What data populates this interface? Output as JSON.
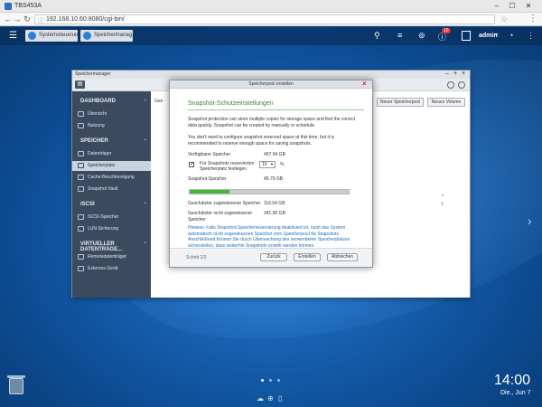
{
  "browser": {
    "tab_title": "TBS453A",
    "url": "192.168.10.60:8080/cgi-bin/",
    "minimize": "–",
    "maximize": "☐",
    "close": "✕"
  },
  "taskbar": {
    "apps": [
      {
        "label": "Systemsteuerun..."
      },
      {
        "label": "Speichermanag..."
      }
    ],
    "notification_count": "10",
    "user": "admin"
  },
  "storage_manager": {
    "title": "Speichermanager",
    "sidebar": {
      "sections": [
        {
          "heading": "DASHBOARD",
          "items": [
            "Übersicht",
            "Nutzung"
          ]
        },
        {
          "heading": "SPEICHER",
          "items": [
            "Datenträger",
            "Speicherplatz",
            "Cache-Beschleunigung",
            "Snapshot Vault"
          ]
        },
        {
          "heading": "iSCSI",
          "items": [
            "iSCSI-Speicher",
            "LUN-Sicherung"
          ]
        },
        {
          "heading": "VIRTUELLER DATENTRÄGE...",
          "items": [
            "Remotedatenträger",
            "Externes Gerät"
          ]
        }
      ],
      "active_item": "Speicherplatz"
    },
    "buttons": {
      "new_pool": "Neuer Speicherpool",
      "new_volume": "Neues Volume"
    },
    "content_label": "Ges",
    "content_marks": [
      "*",
      "I"
    ]
  },
  "dialog": {
    "title": "Speicherpool erstellen",
    "close_icon": "×",
    "heading": "Snapshot-Schutzeinstellungen",
    "intro": "Snapshot protection can store multiple copies for storage space and find the correct data quickly. Snapshot can be created by manually or schedule.",
    "note": "You don't need to configure snapshot reserved space at this time, but it is recommended to reserve enough space for saving snapshots.",
    "available_label": "Verfügbarer Speicher",
    "available_value": "457.94 GB",
    "reserve_checkbox_label": "Für Snapshots reservierten Speicherplatz festlegen",
    "reserve_checked": true,
    "reserve_percent": "10",
    "percent_unit": "%",
    "snapshot_label": "Snapshot-Speicher",
    "snapshot_value": "45.79 GB",
    "snapshot_fill_fraction": 0.25,
    "estimated_label": "Geschätzter zugewiesener Speicher",
    "estimated_value": "116.54 GB",
    "unassigned_label": "Geschätzter nicht zugewiesener Speicher",
    "unassigned_value": "341.00 GB",
    "hint": "Hinweis: Falls Snapshot-Speicherreservierung deaktiviert ist, nutzt das System automatisch nicht zugewiesenen Speicher vom Speicherpool für Snapshots. Anschließend können Sie durch Überwachung des verwendeten Speicherplatzes sicherstellen, dass weiterhin Snapshots erstellt werden können.",
    "step": "Schritt 2/2",
    "back": "Zurück",
    "create": "Erstellen",
    "cancel": "Abbrechen"
  },
  "desktop": {
    "time": "14:00",
    "date": "Die., Jun 7"
  }
}
